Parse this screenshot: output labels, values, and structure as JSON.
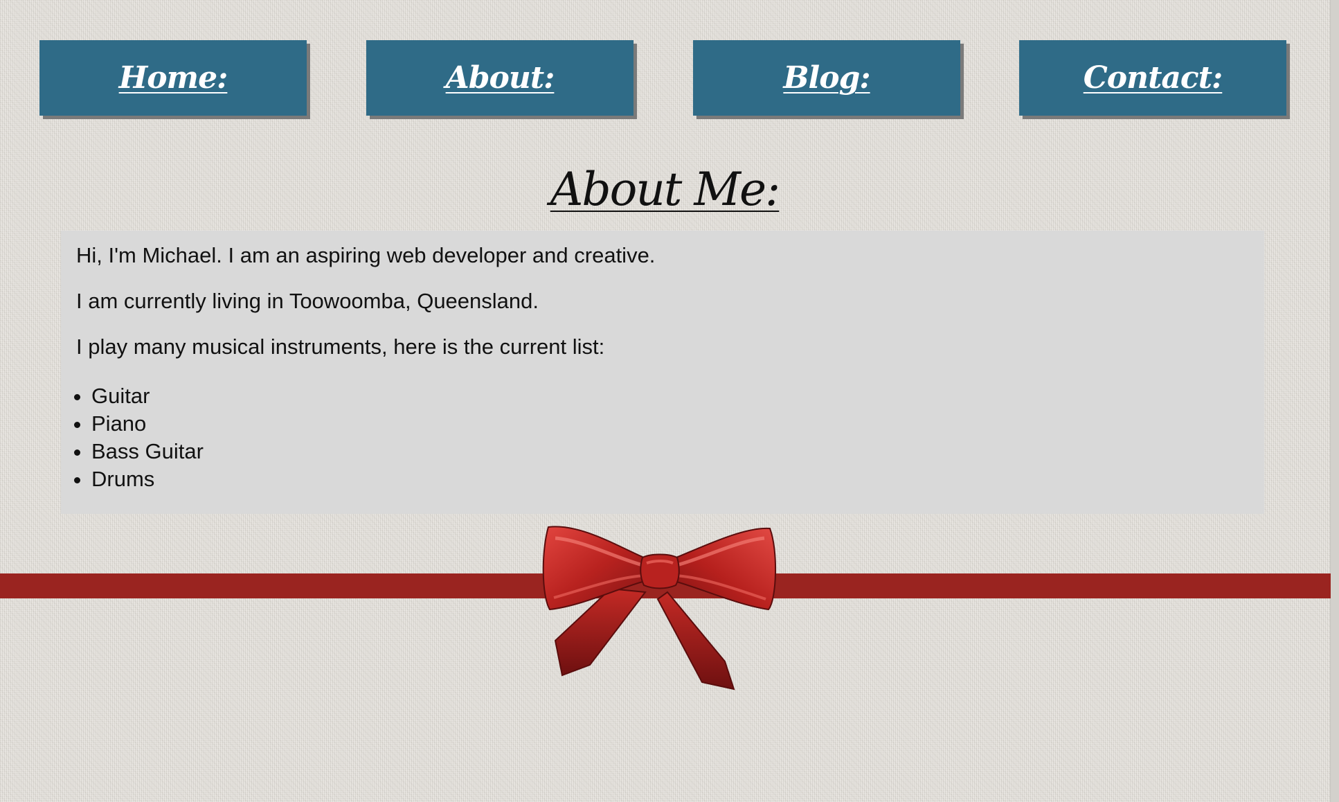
{
  "nav": {
    "items": [
      {
        "label": "Home:"
      },
      {
        "label": "About:"
      },
      {
        "label": "Blog:"
      },
      {
        "label": "Contact:"
      }
    ]
  },
  "main": {
    "title": "About Me:",
    "paragraphs": [
      "Hi, I'm Michael. I am an aspiring web developer and creative.",
      "I am currently living in Toowoomba, Queensland.",
      "I play many musical instruments, here is the current list:"
    ],
    "instruments": [
      "Guitar",
      "Piano",
      "Bass Guitar",
      "Drums"
    ]
  },
  "decor": {
    "ribbon_color": "#9a2420",
    "bow_color": "#c0262a",
    "nav_color": "#2f6b87",
    "content_bg": "#d9d9d9"
  }
}
